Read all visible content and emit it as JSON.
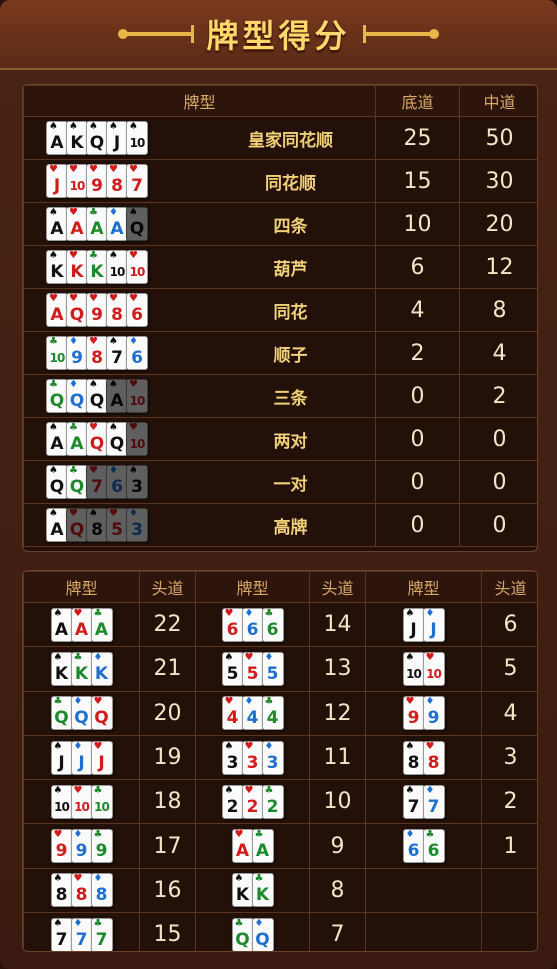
{
  "title": "牌型得分",
  "table1": {
    "headers": [
      "牌型",
      "底道",
      "中道"
    ],
    "rows": [
      {
        "cards": [
          {
            "r": "A",
            "s": "s"
          },
          {
            "r": "K",
            "s": "s"
          },
          {
            "r": "Q",
            "s": "s"
          },
          {
            "r": "J",
            "s": "s"
          },
          {
            "r": "10",
            "s": "s"
          }
        ],
        "name": "皇家同花顺",
        "v1": "25",
        "v2": "50"
      },
      {
        "cards": [
          {
            "r": "J",
            "s": "h"
          },
          {
            "r": "10",
            "s": "h"
          },
          {
            "r": "9",
            "s": "h"
          },
          {
            "r": "8",
            "s": "h"
          },
          {
            "r": "7",
            "s": "h"
          }
        ],
        "name": "同花顺",
        "v1": "15",
        "v2": "30"
      },
      {
        "cards": [
          {
            "r": "A",
            "s": "s"
          },
          {
            "r": "A",
            "s": "h"
          },
          {
            "r": "A",
            "s": "c"
          },
          {
            "r": "A",
            "s": "d"
          },
          {
            "r": "Q",
            "s": "s",
            "dim": true
          }
        ],
        "name": "四条",
        "v1": "10",
        "v2": "20"
      },
      {
        "cards": [
          {
            "r": "K",
            "s": "s"
          },
          {
            "r": "K",
            "s": "h"
          },
          {
            "r": "K",
            "s": "c"
          },
          {
            "r": "10",
            "s": "s"
          },
          {
            "r": "10",
            "s": "h"
          }
        ],
        "name": "葫芦",
        "v1": "6",
        "v2": "12"
      },
      {
        "cards": [
          {
            "r": "A",
            "s": "h"
          },
          {
            "r": "Q",
            "s": "h"
          },
          {
            "r": "9",
            "s": "h"
          },
          {
            "r": "8",
            "s": "h"
          },
          {
            "r": "6",
            "s": "h"
          }
        ],
        "name": "同花",
        "v1": "4",
        "v2": "8"
      },
      {
        "cards": [
          {
            "r": "10",
            "s": "c"
          },
          {
            "r": "9",
            "s": "d"
          },
          {
            "r": "8",
            "s": "h"
          },
          {
            "r": "7",
            "s": "s"
          },
          {
            "r": "6",
            "s": "d"
          }
        ],
        "name": "顺子",
        "v1": "2",
        "v2": "4"
      },
      {
        "cards": [
          {
            "r": "Q",
            "s": "c"
          },
          {
            "r": "Q",
            "s": "d"
          },
          {
            "r": "Q",
            "s": "s"
          },
          {
            "r": "A",
            "s": "s",
            "dim": true
          },
          {
            "r": "10",
            "s": "h",
            "dim": true
          }
        ],
        "name": "三条",
        "v1": "0",
        "v2": "2"
      },
      {
        "cards": [
          {
            "r": "A",
            "s": "s"
          },
          {
            "r": "A",
            "s": "c"
          },
          {
            "r": "Q",
            "s": "h"
          },
          {
            "r": "Q",
            "s": "s"
          },
          {
            "r": "10",
            "s": "h",
            "dim": true
          }
        ],
        "name": "两对",
        "v1": "0",
        "v2": "0"
      },
      {
        "cards": [
          {
            "r": "Q",
            "s": "s"
          },
          {
            "r": "Q",
            "s": "c"
          },
          {
            "r": "7",
            "s": "h",
            "dim": true
          },
          {
            "r": "6",
            "s": "d",
            "dim": true
          },
          {
            "r": "3",
            "s": "s",
            "dim": true
          }
        ],
        "name": "一对",
        "v1": "0",
        "v2": "0"
      },
      {
        "cards": [
          {
            "r": "A",
            "s": "s"
          },
          {
            "r": "Q",
            "s": "h",
            "dim": true
          },
          {
            "r": "8",
            "s": "s",
            "dim": true
          },
          {
            "r": "5",
            "s": "h",
            "dim": true
          },
          {
            "r": "3",
            "s": "d",
            "dim": true
          }
        ],
        "name": "高牌",
        "v1": "0",
        "v2": "0"
      }
    ]
  },
  "table2": {
    "headers": [
      "牌型",
      "头道",
      "牌型",
      "头道",
      "牌型",
      "头道"
    ],
    "columns": [
      [
        {
          "cards": [
            {
              "r": "A",
              "s": "s"
            },
            {
              "r": "A",
              "s": "h"
            },
            {
              "r": "A",
              "s": "c"
            }
          ],
          "score": "22"
        },
        {
          "cards": [
            {
              "r": "K",
              "s": "s"
            },
            {
              "r": "K",
              "s": "c"
            },
            {
              "r": "K",
              "s": "d"
            }
          ],
          "score": "21"
        },
        {
          "cards": [
            {
              "r": "Q",
              "s": "c"
            },
            {
              "r": "Q",
              "s": "d"
            },
            {
              "r": "Q",
              "s": "h"
            }
          ],
          "score": "20"
        },
        {
          "cards": [
            {
              "r": "J",
              "s": "s"
            },
            {
              "r": "J",
              "s": "d"
            },
            {
              "r": "J",
              "s": "h"
            }
          ],
          "score": "19"
        },
        {
          "cards": [
            {
              "r": "10",
              "s": "s"
            },
            {
              "r": "10",
              "s": "h"
            },
            {
              "r": "10",
              "s": "c"
            }
          ],
          "score": "18"
        },
        {
          "cards": [
            {
              "r": "9",
              "s": "h"
            },
            {
              "r": "9",
              "s": "d"
            },
            {
              "r": "9",
              "s": "c"
            }
          ],
          "score": "17"
        },
        {
          "cards": [
            {
              "r": "8",
              "s": "s"
            },
            {
              "r": "8",
              "s": "h"
            },
            {
              "r": "8",
              "s": "d"
            }
          ],
          "score": "16"
        },
        {
          "cards": [
            {
              "r": "7",
              "s": "s"
            },
            {
              "r": "7",
              "s": "d"
            },
            {
              "r": "7",
              "s": "c"
            }
          ],
          "score": "15"
        }
      ],
      [
        {
          "cards": [
            {
              "r": "6",
              "s": "h"
            },
            {
              "r": "6",
              "s": "d"
            },
            {
              "r": "6",
              "s": "c"
            }
          ],
          "score": "14"
        },
        {
          "cards": [
            {
              "r": "5",
              "s": "s"
            },
            {
              "r": "5",
              "s": "h"
            },
            {
              "r": "5",
              "s": "d"
            }
          ],
          "score": "13"
        },
        {
          "cards": [
            {
              "r": "4",
              "s": "h"
            },
            {
              "r": "4",
              "s": "d"
            },
            {
              "r": "4",
              "s": "c"
            }
          ],
          "score": "12"
        },
        {
          "cards": [
            {
              "r": "3",
              "s": "s"
            },
            {
              "r": "3",
              "s": "h"
            },
            {
              "r": "3",
              "s": "d"
            }
          ],
          "score": "11"
        },
        {
          "cards": [
            {
              "r": "2",
              "s": "s"
            },
            {
              "r": "2",
              "s": "h"
            },
            {
              "r": "2",
              "s": "c"
            }
          ],
          "score": "10"
        },
        {
          "cards": [
            {
              "r": "A",
              "s": "h"
            },
            {
              "r": "A",
              "s": "c"
            }
          ],
          "score": "9"
        },
        {
          "cards": [
            {
              "r": "K",
              "s": "s"
            },
            {
              "r": "K",
              "s": "c"
            }
          ],
          "score": "8"
        },
        {
          "cards": [
            {
              "r": "Q",
              "s": "c"
            },
            {
              "r": "Q",
              "s": "d"
            }
          ],
          "score": "7"
        }
      ],
      [
        {
          "cards": [
            {
              "r": "J",
              "s": "s"
            },
            {
              "r": "J",
              "s": "d"
            }
          ],
          "score": "6"
        },
        {
          "cards": [
            {
              "r": "10",
              "s": "s"
            },
            {
              "r": "10",
              "s": "h"
            }
          ],
          "score": "5"
        },
        {
          "cards": [
            {
              "r": "9",
              "s": "h"
            },
            {
              "r": "9",
              "s": "d"
            }
          ],
          "score": "4"
        },
        {
          "cards": [
            {
              "r": "8",
              "s": "s"
            },
            {
              "r": "8",
              "s": "h"
            }
          ],
          "score": "3"
        },
        {
          "cards": [
            {
              "r": "7",
              "s": "s"
            },
            {
              "r": "7",
              "s": "d"
            }
          ],
          "score": "2"
        },
        {
          "cards": [
            {
              "r": "6",
              "s": "d"
            },
            {
              "r": "6",
              "s": "c"
            }
          ],
          "score": "1"
        }
      ]
    ]
  },
  "suit_symbols": {
    "s": "♠",
    "h": "♥",
    "d": "♦",
    "c": "♣"
  },
  "colors": {
    "title": "#ffd76a",
    "spade": "#111111",
    "heart": "#d21c1c",
    "diamond": "#1f6fd0",
    "club": "#1c8a2c",
    "background": "#3a1a10"
  }
}
